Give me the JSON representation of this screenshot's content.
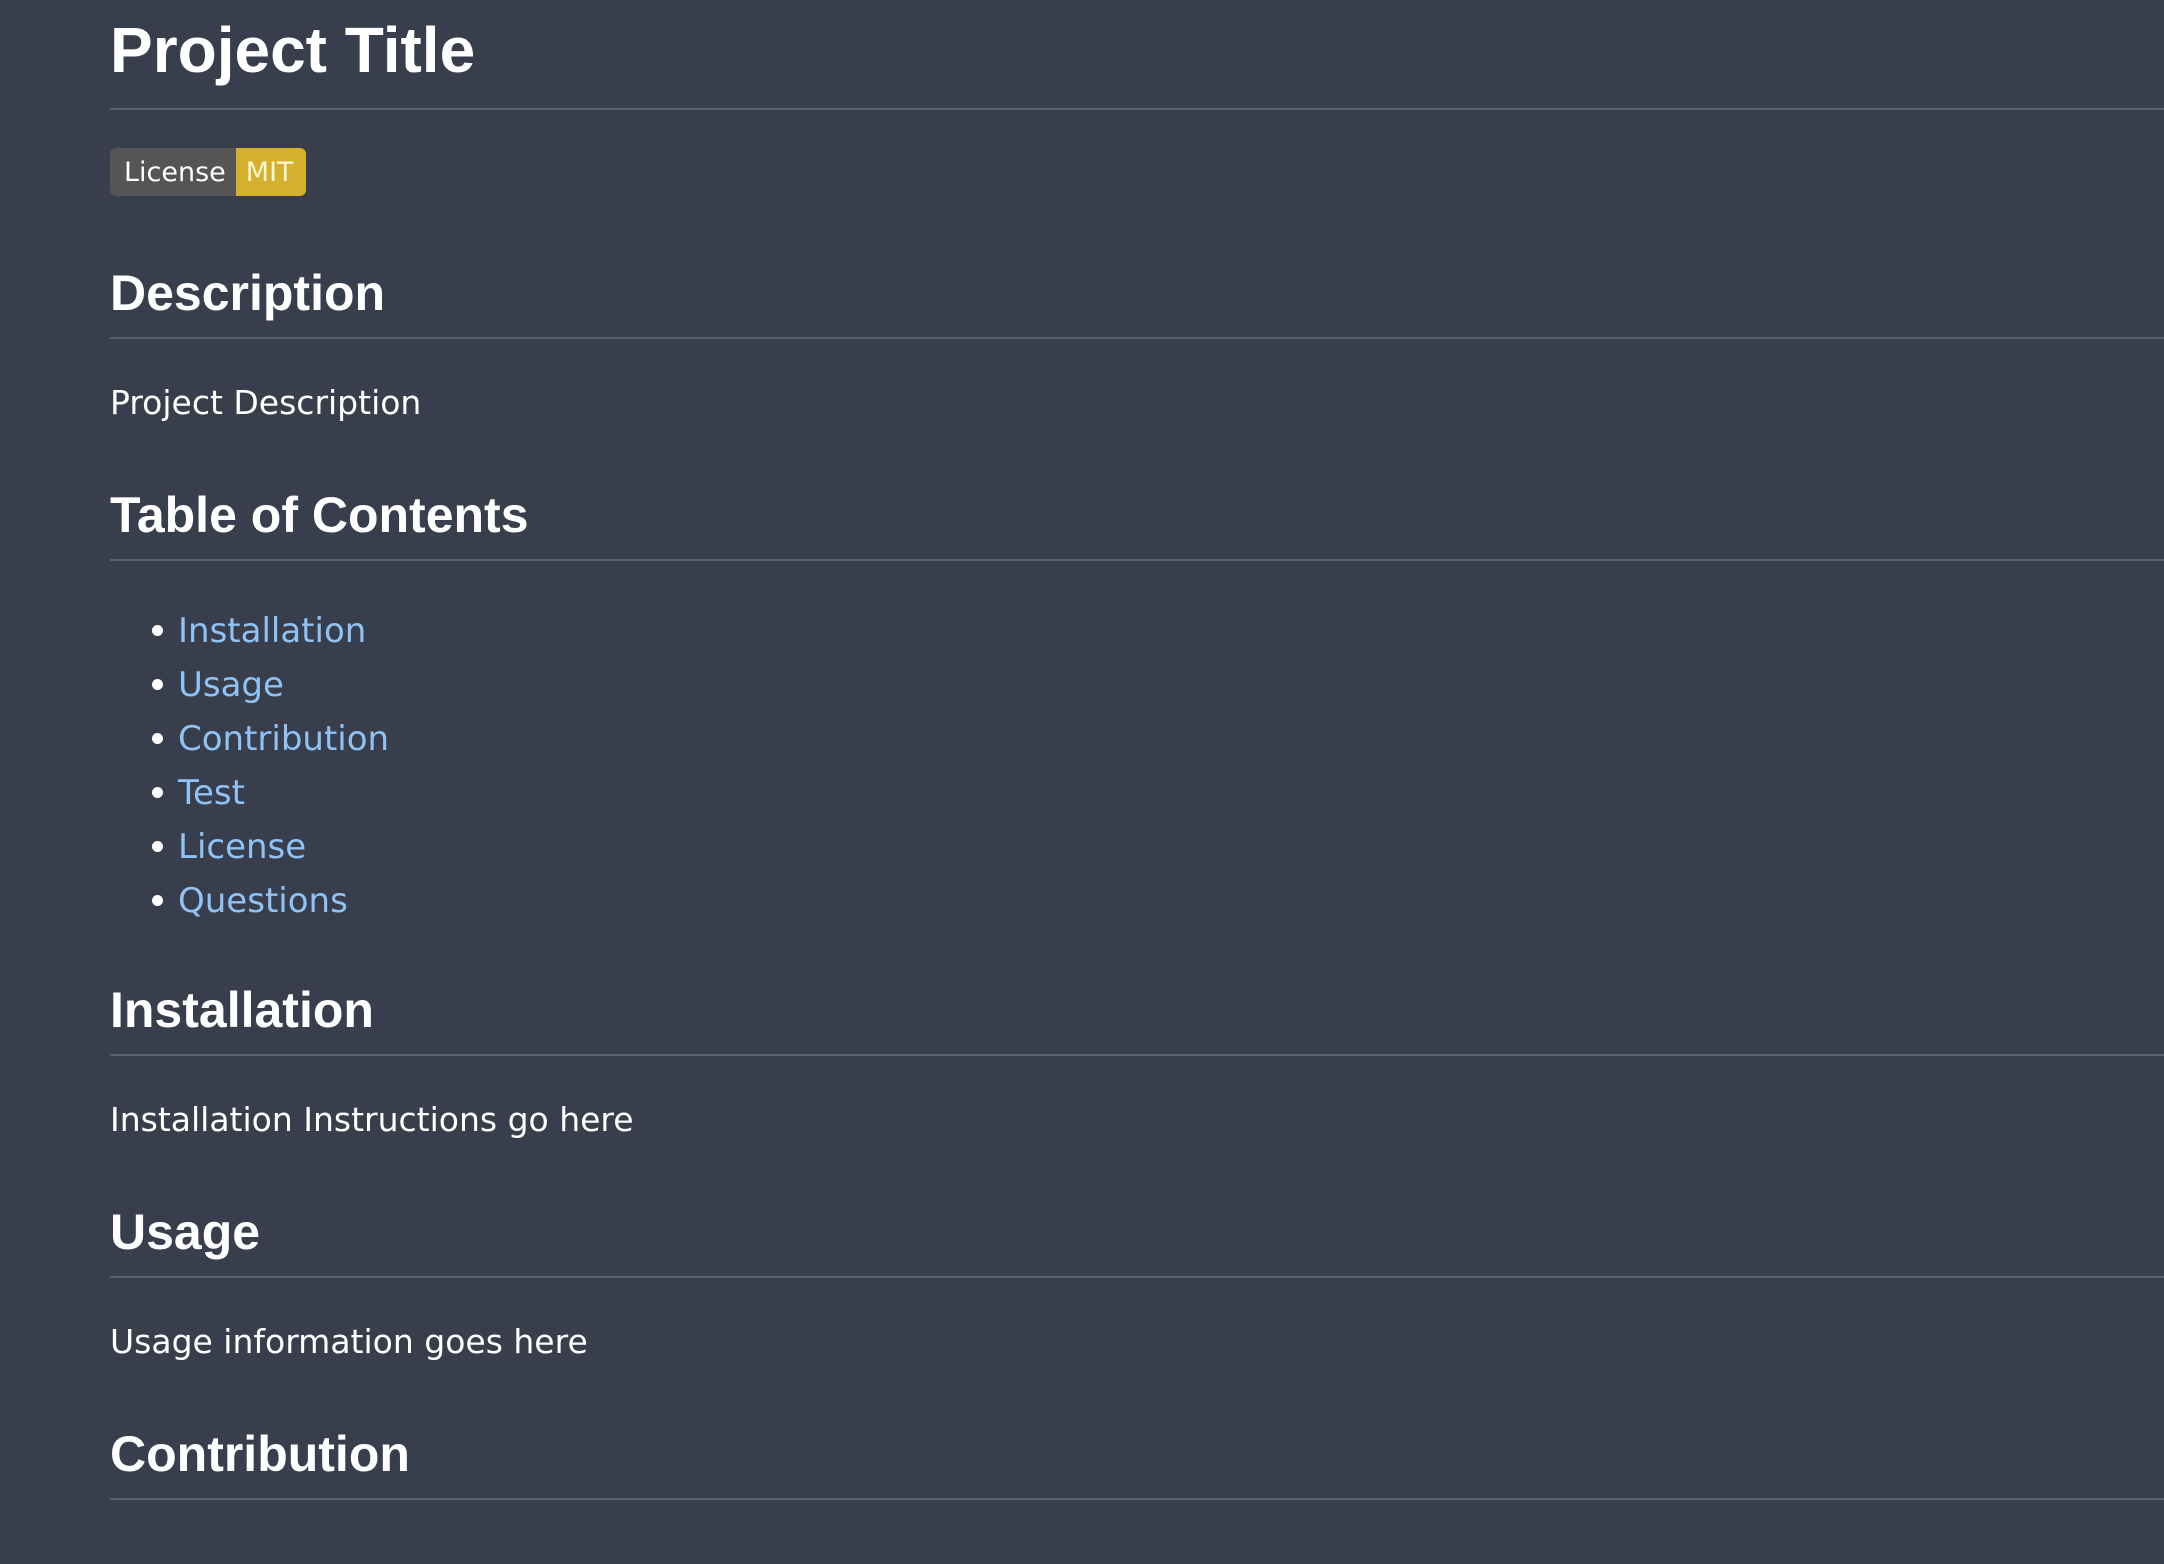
{
  "title": "Project Title",
  "badge": {
    "label": "License",
    "value": "MIT",
    "label_color": "#555555",
    "value_color": "#d4b02e"
  },
  "sections": {
    "description": {
      "heading": "Description",
      "body": "Project Description"
    },
    "toc": {
      "heading": "Table of Contents",
      "items": [
        "Installation",
        "Usage",
        "Contribution",
        "Test",
        "License",
        "Questions"
      ]
    },
    "installation": {
      "heading": "Installation",
      "body": "Installation Instructions go here"
    },
    "usage": {
      "heading": "Usage",
      "body": "Usage information goes here"
    },
    "contribution": {
      "heading": "Contribution"
    }
  },
  "colors": {
    "background": "#393e4d",
    "link": "#8fc3f5",
    "rule": "#5b6070"
  }
}
